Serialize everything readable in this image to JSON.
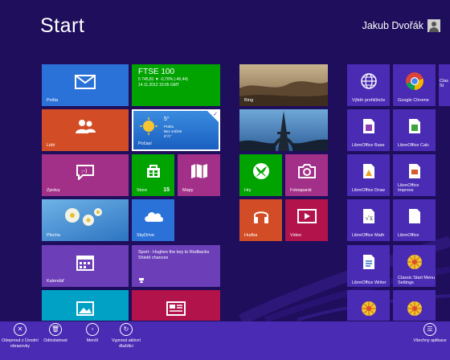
{
  "header": {
    "title": "Start",
    "user_name": "Jakub Dvořák"
  },
  "colors": {
    "background": "#1e0e5c",
    "app_bar": "#4a2bb4",
    "blue": "#2b72d8",
    "orange": "#d24d25",
    "green": "#00a300",
    "purple": "#7e1a9e",
    "magenta": "#a33088",
    "teal": "#00a1c4",
    "red": "#b2134a",
    "violet": "#6c3fb8"
  },
  "tiles": {
    "mail": "Pošta",
    "finance": {
      "title": "FTSE 100",
      "line1": "5 745,81 ▼ -0,70% (-40,44)",
      "line2": "14.11.2012 15:05 GMT"
    },
    "photos_bing": "Bing",
    "control_panel": "Výběr prohlížeče",
    "chrome": "Google Chrome",
    "classic": "Clas St",
    "people": "Lidé",
    "weather": {
      "label": "Počasí",
      "temp": "5°",
      "city": "Praha",
      "condition": "Bez srážek",
      "range": "6°/1°"
    },
    "desktop_sub": "",
    "lo_base": "LibreOffice Base",
    "lo_calc": "LibreOffice Calc",
    "messaging": "Zprávy",
    "store": "Store",
    "store_badge": "15",
    "maps": "Mapy",
    "games": "Hry",
    "camera": "Fotoaparát",
    "lo_draw": "LibreOffice Draw",
    "lo_impress": "LibreOffice Impress",
    "desktop": "Plocha",
    "skydrive": "SkyDrive",
    "music": "Hudba",
    "video": "Video",
    "lo_math": "LibreOffice Math",
    "lo": "LibreOffice",
    "calendar": "Kalendář",
    "sport": "Sport - Hughes the key to Redbacks Shield chances",
    "lo_writer": "LibreOffice Writer",
    "classic_settings": "Classic Start Menu Settings"
  },
  "app_bar": {
    "unpin": "Odepnout z Úvodní obrazovky",
    "uninstall": "Odinstalovat",
    "smaller": "Menší",
    "turn_off_live": "Vypnout aktivní dlaždici",
    "all_apps": "Všechny aplikace"
  },
  "icons": [
    "mail-icon",
    "people-icon",
    "messaging-icon",
    "store-icon",
    "maps-icon",
    "games-icon",
    "camera-icon",
    "music-icon",
    "video-icon",
    "skydrive-icon",
    "calendar-icon",
    "photos-icon",
    "news-icon",
    "chrome-icon",
    "unpin-icon",
    "uninstall-icon",
    "smaller-icon",
    "live-tile-off-icon",
    "all-apps-icon"
  ]
}
